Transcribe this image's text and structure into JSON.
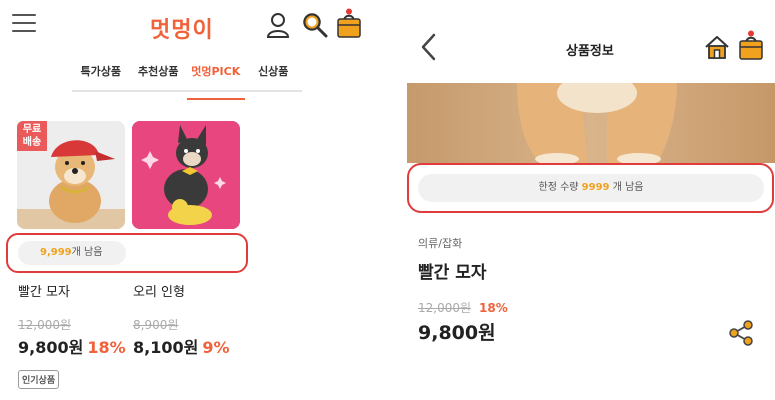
{
  "left": {
    "logo": "멋멍이",
    "tabs": [
      {
        "label": "특가상품"
      },
      {
        "label": "추천상품"
      },
      {
        "label": "멋멍PICK"
      },
      {
        "label": "신상품"
      }
    ],
    "active_tab": "멋멍PICK",
    "free_shipping_badge": "무료배송",
    "free_shipping_line1": "무료",
    "free_shipping_line2": "배송",
    "stock": {
      "count": "9,999",
      "suffix": "개 남음"
    },
    "products": [
      {
        "name": "빨간 모자",
        "original_price": "12,000원",
        "price": "9,800원",
        "discount": "18%"
      },
      {
        "name": "오리 인형",
        "original_price": "8,900원",
        "price": "8,100원",
        "discount": "9%"
      }
    ],
    "tag": "인기상품"
  },
  "right": {
    "title": "상품정보",
    "stock": {
      "prefix": "한정 수량",
      "count": "9999",
      "suffix": "개 남음"
    },
    "category": "의류/잡화",
    "product_name": "빨간 모자",
    "original_price": "12,000원",
    "discount": "18%",
    "price": "9,800원"
  },
  "colors": {
    "brand": "#f0623a",
    "highlight_border": "#e03c3c",
    "stock_number": "#f0a21e",
    "badge": "#ea5a5a",
    "cart_bag": "#f0a21e",
    "cart_dot": "#e53935"
  },
  "icons": [
    "hamburger-menu-icon",
    "user-icon",
    "search-icon",
    "shopping-bag-icon",
    "back-arrow-icon",
    "home-icon",
    "share-icon"
  ]
}
